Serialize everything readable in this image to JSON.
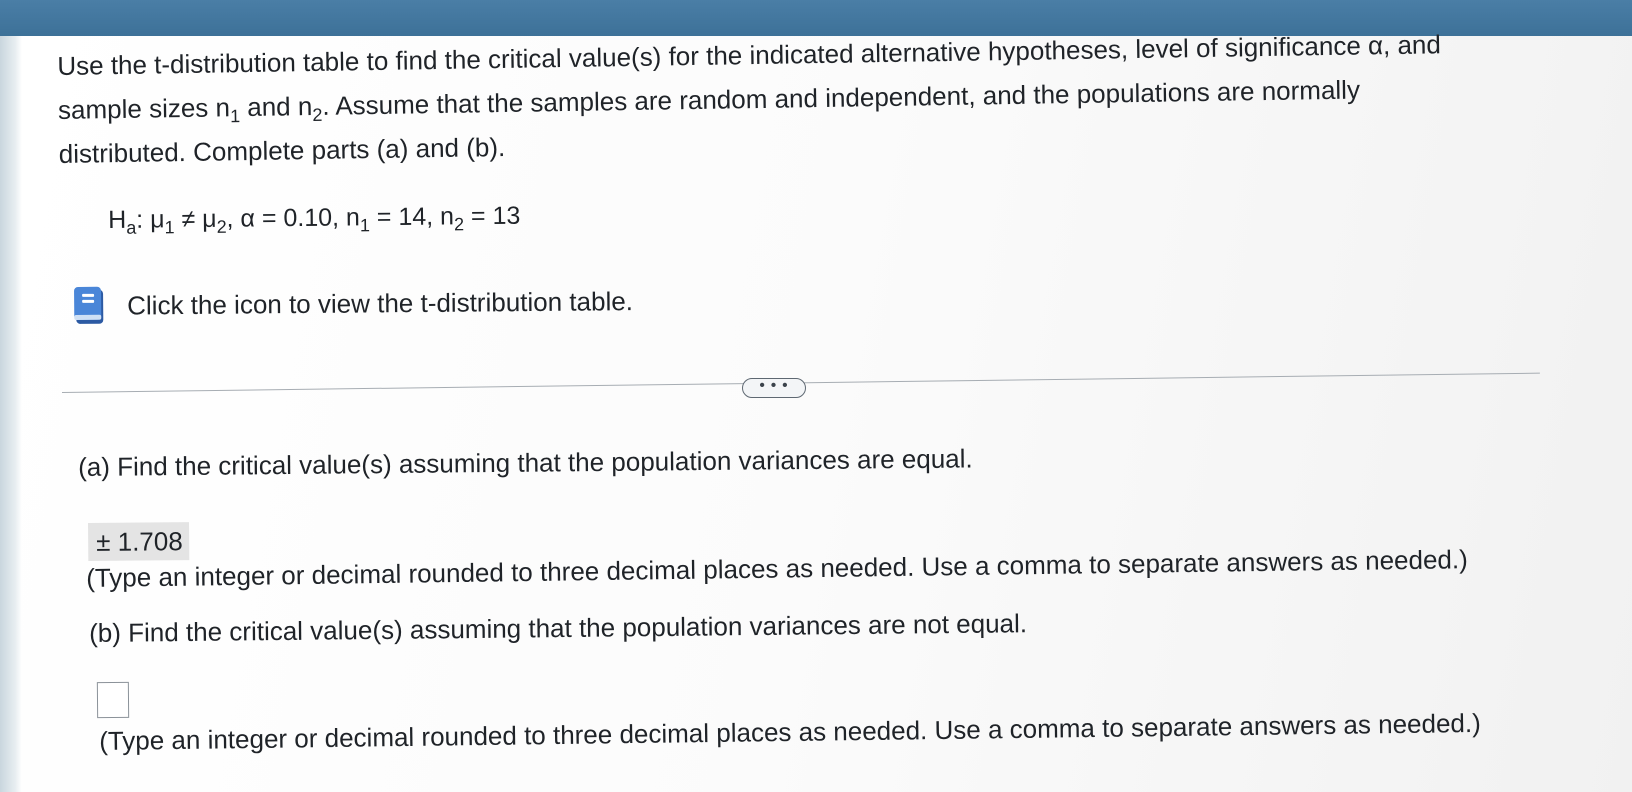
{
  "prompt": {
    "line1": "Use the t-distribution table to find the critical value(s) for the indicated alternative hypotheses, level of significance α, and",
    "line2_pre": "sample sizes n",
    "line2_sub1": "1",
    "line2_mid": " and n",
    "line2_sub2": "2",
    "line2_post": ". Assume that the samples are random and independent, and the populations are normally",
    "line3": "distributed. Complete parts (a) and (b)."
  },
  "hypothesis": {
    "h": "H",
    "h_sub": "a",
    "mu1": ": μ",
    "mu1_sub": "1",
    "neq": " ≠ μ",
    "mu2_sub": "2",
    "alpha_part": ", α = 0.10, n",
    "n1_sub": "1",
    "n1_val": " = 14, n",
    "n2_sub": "2",
    "n2_val": " = 13"
  },
  "table_link": {
    "icon": "book-icon",
    "label": "Click the icon to view the t-distribution table."
  },
  "divider": {
    "more_label": "• • •"
  },
  "part_a": {
    "question": "(a) Find the critical value(s) assuming that the population variances are equal.",
    "answer": "± 1.708",
    "note": "(Type an integer or decimal rounded to three decimal places as needed. Use a comma to separate answers as needed.)"
  },
  "part_b": {
    "question": "(b) Find the critical value(s) assuming that the population variances are not equal.",
    "answer": "",
    "note": "(Type an integer or decimal rounded to three decimal places as needed. Use a comma to separate answers as needed.)"
  },
  "colors": {
    "top_bar": "#3d7198",
    "icon_blue": "#3f74c9",
    "answer_bg": "#e4e4e4"
  }
}
